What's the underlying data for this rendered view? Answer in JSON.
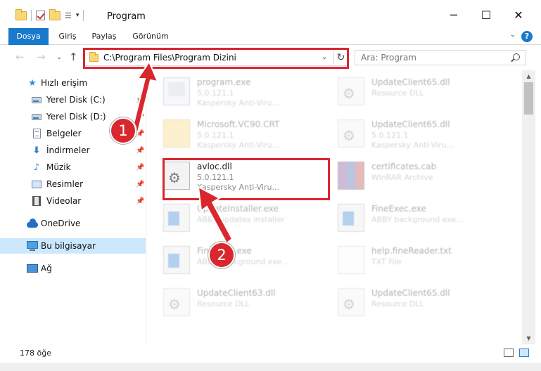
{
  "window": {
    "title": "Program",
    "minimize": "─",
    "maximize": "☐",
    "close": "✕"
  },
  "ribbon": {
    "tabs": [
      "Dosya",
      "Giriş",
      "Paylaş",
      "Görünüm"
    ],
    "help": "?"
  },
  "address": {
    "path": "C:\\Program Files\\Program Dizini",
    "dropdown": "⌄",
    "refresh": "↻"
  },
  "search": {
    "placeholder": "Ara: Program"
  },
  "nav": {
    "back": "←",
    "forward": "→",
    "recent": "⌄",
    "up": "↑"
  },
  "sidebar": {
    "quick_access": "Hızlı erişim",
    "items": [
      {
        "label": "Yerel Disk (C:)",
        "icon": "disk-icon"
      },
      {
        "label": "Yerel Disk (D:)",
        "icon": "disk-icon"
      },
      {
        "label": "Belgeler",
        "icon": "documents-icon"
      },
      {
        "label": "İndirmeler",
        "icon": "downloads-icon"
      },
      {
        "label": "Müzik",
        "icon": "music-icon"
      },
      {
        "label": "Resimler",
        "icon": "pictures-icon"
      },
      {
        "label": "Videolar",
        "icon": "videos-icon"
      }
    ],
    "onedrive": "OneDrive",
    "this_pc": "Bu bilgisayar",
    "network": "Ağ"
  },
  "files": [
    {
      "name": "program.exe",
      "line1": "5.0.121.1",
      "line2": "Kaspersky Anti-Viru...",
      "icon": "exe-icon"
    },
    {
      "name": "UpdateClient65.dll",
      "line1": "Resource DLL",
      "line2": "",
      "icon": "dll-icon"
    },
    {
      "name": "Microsoft.VC90.CRT",
      "line1": "5.0.121.1",
      "line2": "Kaspersky Anti-Viru...",
      "icon": "folder-icon"
    },
    {
      "name": "UpdateClient65.dll",
      "line1": "5.0.121.1",
      "line2": "Kaspersky Anti-Viru...",
      "icon": "dll-icon"
    },
    {
      "name": "avloc.dll",
      "line1": "5.0.121.1",
      "line2": "Kaspersky Anti-Viru...",
      "icon": "dll-icon"
    },
    {
      "name": "certificates.cab",
      "line1": "WinRAR Archive",
      "line2": "",
      "icon": "archive-icon"
    },
    {
      "name": "UpdateInstaller.exe",
      "line1": "ABBY updates installer",
      "line2": "",
      "icon": "exe-icon"
    },
    {
      "name": "FineExec.exe",
      "line1": "ABBY background exe...",
      "line2": "",
      "icon": "exe-icon"
    },
    {
      "name": "FineExec.exe",
      "line1": "ABBY background exe...",
      "line2": "",
      "icon": "exe-icon"
    },
    {
      "name": "help.fineReader.txt",
      "line1": "TXT File",
      "line2": "",
      "icon": "text-file-icon"
    },
    {
      "name": "UpdateClient63.dll",
      "line1": "Resource DLL",
      "line2": "",
      "icon": "dll-icon"
    },
    {
      "name": "UpdateClient65.dll",
      "line1": "Resource DLL",
      "line2": "",
      "icon": "dll-icon"
    }
  ],
  "status": {
    "count": "178 öğe"
  },
  "annotations": {
    "step1": "1",
    "step2": "2"
  },
  "colors": {
    "accent": "#1979ca",
    "highlight": "#d9272e",
    "selected": "#cce8ff"
  }
}
